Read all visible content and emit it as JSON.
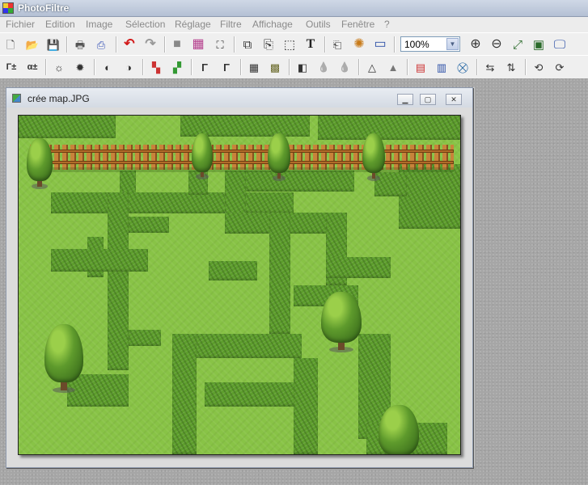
{
  "app": {
    "title": "PhotoFiltre"
  },
  "menu": [
    "Fichier",
    "Edition",
    "Image",
    "Sélection",
    "Réglage",
    "Filtre",
    "Affichage",
    "Outils",
    "Fenêtre",
    "?"
  ],
  "zoom": {
    "value": "100%"
  },
  "document": {
    "title": "crée map.JPG"
  },
  "toolbar1": [
    {
      "name": "new-file-icon",
      "glyph": "🗋"
    },
    {
      "name": "open-folder-icon",
      "glyph": "📂"
    },
    {
      "name": "save-icon",
      "glyph": "💾"
    },
    {
      "name": "print-icon",
      "glyph": "🖶"
    },
    {
      "name": "scan-icon",
      "glyph": "⎙"
    },
    {
      "name": "undo-icon",
      "glyph": "↶"
    },
    {
      "name": "redo-icon",
      "glyph": "↷"
    },
    {
      "name": "gray-square-icon",
      "glyph": "■"
    },
    {
      "name": "color-palette-icon",
      "glyph": "▦"
    },
    {
      "name": "stamp-icon",
      "glyph": "⛶"
    },
    {
      "name": "copy-image-icon",
      "glyph": "⧉"
    },
    {
      "name": "paste-image-icon",
      "glyph": "⎘"
    },
    {
      "name": "select-crop-icon",
      "glyph": "⬚"
    },
    {
      "name": "text-icon",
      "glyph": "T"
    },
    {
      "name": "layers-icon",
      "glyph": "⎗"
    },
    {
      "name": "filter-star-icon",
      "glyph": "✺"
    },
    {
      "name": "window-icon",
      "glyph": "▭"
    },
    {
      "name": "zoom-in-icon",
      "glyph": "⊕"
    },
    {
      "name": "zoom-out-icon",
      "glyph": "⊖"
    },
    {
      "name": "fit-image-icon",
      "glyph": "⤢"
    },
    {
      "name": "actual-size-icon",
      "glyph": "▣"
    },
    {
      "name": "fullscreen-icon",
      "glyph": "🖵"
    }
  ],
  "toolbar2": [
    {
      "name": "auto-levels-icon",
      "glyph": "Γ±"
    },
    {
      "name": "auto-contrast-icon",
      "glyph": "α±"
    },
    {
      "name": "brightness-down-icon",
      "glyph": "☼"
    },
    {
      "name": "brightness-up-icon",
      "glyph": "✹"
    },
    {
      "name": "contrast-down-icon",
      "glyph": "◐"
    },
    {
      "name": "contrast-up-icon",
      "glyph": "◑"
    },
    {
      "name": "saturation-down-icon",
      "glyph": "▚"
    },
    {
      "name": "saturation-up-icon",
      "glyph": "▞"
    },
    {
      "name": "gamma-down-icon",
      "glyph": "Γ"
    },
    {
      "name": "gamma-up-icon",
      "glyph": "Γ"
    },
    {
      "name": "grid-icon",
      "glyph": "▦"
    },
    {
      "name": "pattern-icon",
      "glyph": "▩"
    },
    {
      "name": "emboss-icon",
      "glyph": "◧"
    },
    {
      "name": "drop-blur-icon",
      "glyph": "💧"
    },
    {
      "name": "drop-sharpen-icon",
      "glyph": "💧"
    },
    {
      "name": "triangle-icon",
      "glyph": "△"
    },
    {
      "name": "triangle-plus-icon",
      "glyph": "▲"
    },
    {
      "name": "rgb-icon",
      "glyph": "▤"
    },
    {
      "name": "gradient-icon",
      "glyph": "▥"
    },
    {
      "name": "transform-icon",
      "glyph": "⛒"
    },
    {
      "name": "flip-horizontal-icon",
      "glyph": "⇆"
    },
    {
      "name": "flip-vertical-icon",
      "glyph": "⇅"
    },
    {
      "name": "rotate-left-icon",
      "glyph": "⟲"
    },
    {
      "name": "rotate-right-icon",
      "glyph": "⟳"
    }
  ]
}
